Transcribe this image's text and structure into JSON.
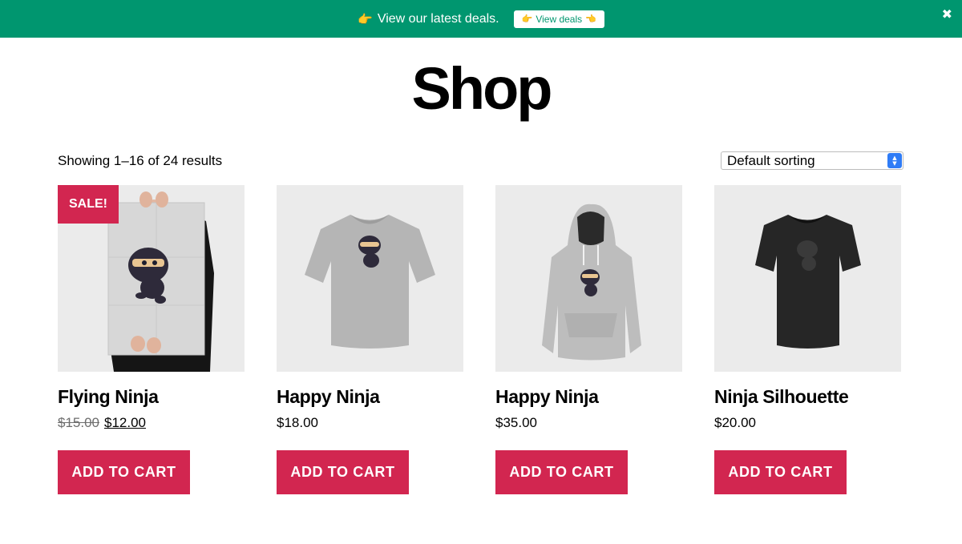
{
  "promo": {
    "pointer_emoji": "👉",
    "text": "View our latest deals.",
    "button_label": "View deals",
    "button_emoji_left": "👉",
    "button_emoji_right": "👈",
    "close_glyph": "✖",
    "color": "#00966f"
  },
  "page": {
    "title": "Shop"
  },
  "toolbar": {
    "result_count": "Showing 1–16 of 24 results",
    "sorting": {
      "selected": "Default sorting"
    }
  },
  "products": [
    {
      "name": "Flying Ninja",
      "regular_price": "$15.00",
      "sale_price": "$12.00",
      "on_sale": true,
      "badge": "SALE!",
      "image": "poster-icon",
      "cta": "ADD TO CART"
    },
    {
      "name": "Happy Ninja",
      "price": "$18.00",
      "image": "tshirt-icon",
      "cta": "ADD TO CART"
    },
    {
      "name": "Happy Ninja",
      "price": "$35.00",
      "image": "hoodie-icon",
      "cta": "ADD TO CART"
    },
    {
      "name": "Ninja Silhouette",
      "price": "$20.00",
      "image": "black-tshirt-icon",
      "cta": "ADD TO CART"
    }
  ],
  "colors": {
    "accent": "#d22650",
    "promo_bg": "#00966f",
    "image_bg": "#ebebeb"
  }
}
